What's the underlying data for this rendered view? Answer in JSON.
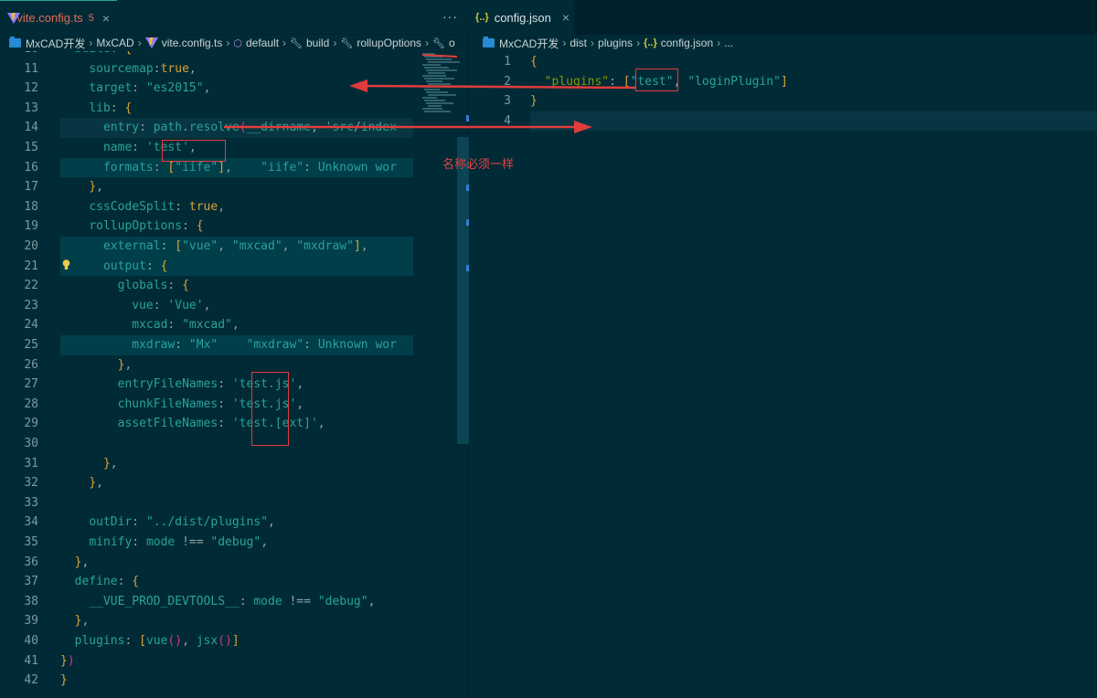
{
  "tabs": {
    "left": {
      "name": "vite.config.ts",
      "badge": "5",
      "close": "×",
      "more": "···"
    },
    "right": {
      "name": "config.json",
      "close": "×",
      "icon": "{..}"
    }
  },
  "breadcrumbs": {
    "left": [
      "MxCAD开发",
      "MxCAD",
      "vite.config.ts",
      "default",
      "build",
      "rollupOptions",
      "o"
    ],
    "right": [
      "MxCAD开发",
      "dist",
      "plugins",
      "config.json",
      "..."
    ]
  },
  "left_editor": {
    "lines": [
      {
        "n": "10",
        "text": "  build: {"
      },
      {
        "n": "11",
        "text": "    sourcemap:true,"
      },
      {
        "n": "12",
        "text": "    target: \"es2015\","
      },
      {
        "n": "13",
        "text": "    lib: {"
      },
      {
        "n": "14",
        "text": "      entry: path.resolve(__dirname, 'src/index"
      },
      {
        "n": "15",
        "text": "      name: 'test',"
      },
      {
        "n": "16",
        "text": "      formats: [\"iife\"],    \"iife\": Unknown wor"
      },
      {
        "n": "17",
        "text": "    },"
      },
      {
        "n": "18",
        "text": "    cssCodeSplit: true,"
      },
      {
        "n": "19",
        "text": "    rollupOptions: {"
      },
      {
        "n": "20",
        "text": "      external: [\"vue\", \"mxcad\", \"mxdraw\"],"
      },
      {
        "n": "21",
        "text": "      output: {"
      },
      {
        "n": "22",
        "text": "        globals: {"
      },
      {
        "n": "23",
        "text": "          vue: 'Vue',"
      },
      {
        "n": "24",
        "text": "          mxcad: \"mxcad\","
      },
      {
        "n": "25",
        "text": "          mxdraw: \"Mx\"    \"mxdraw\": Unknown wor"
      },
      {
        "n": "26",
        "text": "        },"
      },
      {
        "n": "27",
        "text": "        entryFileNames: 'test.js',"
      },
      {
        "n": "28",
        "text": "        chunkFileNames: 'test.js',"
      },
      {
        "n": "29",
        "text": "        assetFileNames: 'test.[ext]',"
      },
      {
        "n": "30",
        "text": ""
      },
      {
        "n": "31",
        "text": "      },"
      },
      {
        "n": "32",
        "text": "    },"
      },
      {
        "n": "33",
        "text": ""
      },
      {
        "n": "34",
        "text": "    outDir: \"../dist/plugins\","
      },
      {
        "n": "35",
        "text": "    minify: mode !== \"debug\","
      },
      {
        "n": "36",
        "text": "  },"
      },
      {
        "n": "37",
        "text": "  define: {"
      },
      {
        "n": "38",
        "text": "    __VUE_PROD_DEVTOOLS__: mode !== \"debug\","
      },
      {
        "n": "39",
        "text": "  },"
      },
      {
        "n": "40",
        "text": "  plugins: [vue(), jsx()]"
      },
      {
        "n": "41",
        "text": "})"
      },
      {
        "n": "42",
        "text": "}"
      }
    ]
  },
  "right_editor": {
    "lines": [
      {
        "n": "1",
        "text": "{"
      },
      {
        "n": "2",
        "text": "  \"plugins\": [\"test\", \"loginPlugin\"]"
      },
      {
        "n": "3",
        "text": "}"
      },
      {
        "n": "4",
        "text": ""
      }
    ]
  },
  "annotation": {
    "note": "名称必须一样"
  },
  "colors": {
    "background": "#002b36",
    "annotation": "#e03c3c",
    "string": "#2aa198",
    "keyword": "#859900"
  }
}
